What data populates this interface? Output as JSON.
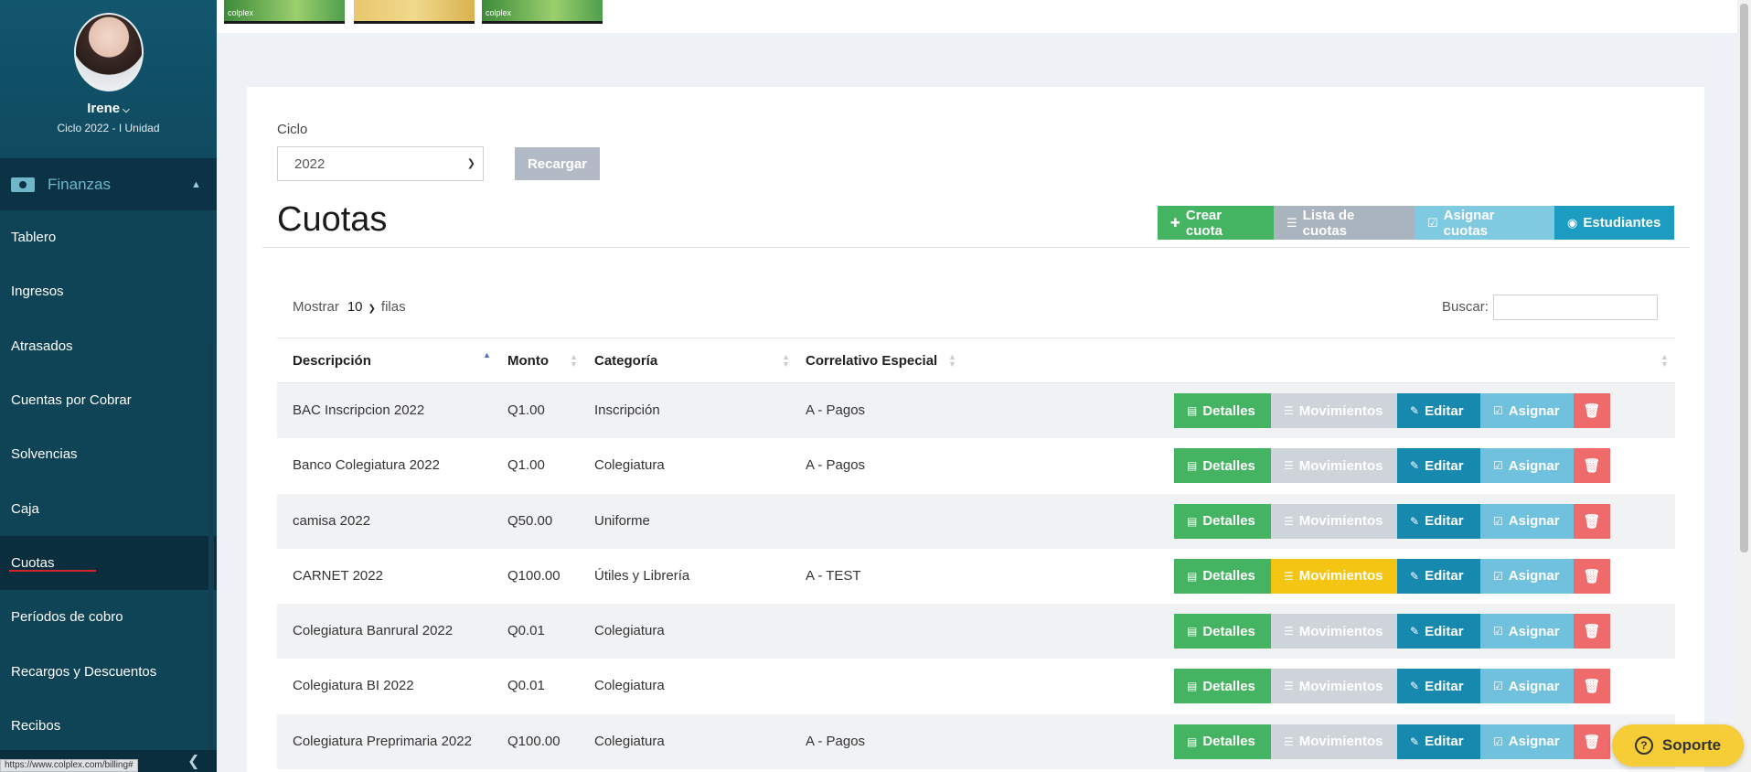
{
  "sidebar": {
    "user_name": "Irene",
    "user_cycle": "Ciclo 2022 - I Unidad",
    "group_label": "Finanzas",
    "items": [
      {
        "label": "Tablero"
      },
      {
        "label": "Ingresos"
      },
      {
        "label": "Atrasados"
      },
      {
        "label": "Cuentas por Cobrar"
      },
      {
        "label": "Solvencias"
      },
      {
        "label": "Caja"
      },
      {
        "label": "Cuotas"
      },
      {
        "label": "Períodos de cobro"
      },
      {
        "label": "Recargos y Descuentos"
      },
      {
        "label": "Recibos"
      }
    ],
    "active_item": "Cuotas",
    "status_url": "https://www.colplex.com/billing#"
  },
  "banners": [
    {
      "text": "colplex"
    },
    {
      "text": ""
    },
    {
      "text": "colplex"
    }
  ],
  "filters": {
    "ciclo_label": "Ciclo",
    "ciclo_value": "2022",
    "reload_label": "Recargar"
  },
  "page": {
    "title": "Cuotas",
    "actions": {
      "create": "Crear cuota",
      "list": "Lista de cuotas",
      "assign": "Asignar cuotas",
      "students": "Estudiantes"
    }
  },
  "table_controls": {
    "show_label": "Mostrar",
    "page_length": "10",
    "rows_label": "filas",
    "search_label": "Buscar:"
  },
  "table": {
    "columns": [
      "Descripción",
      "Monto",
      "Categoría",
      "Correlativo Especial"
    ],
    "button_labels": {
      "details": "Detalles",
      "movements": "Movimientos",
      "edit": "Editar",
      "assign": "Asignar"
    },
    "rows": [
      {
        "descripcion": "BAC Inscripcion 2022",
        "monto": "Q1.00",
        "categoria": "Inscripción",
        "correlativo": "A - Pagos",
        "movimientos_enabled": false
      },
      {
        "descripcion": "Banco Colegiatura 2022",
        "monto": "Q1.00",
        "categoria": "Colegiatura",
        "correlativo": "A - Pagos",
        "movimientos_enabled": false
      },
      {
        "descripcion": "camisa 2022",
        "monto": "Q50.00",
        "categoria": "Uniforme",
        "correlativo": "",
        "movimientos_enabled": false
      },
      {
        "descripcion": "CARNET 2022",
        "monto": "Q100.00",
        "categoria": "Útiles y Librería",
        "correlativo": "A - TEST",
        "movimientos_enabled": true
      },
      {
        "descripcion": "Colegiatura Banrural 2022",
        "monto": "Q0.01",
        "categoria": "Colegiatura",
        "correlativo": "",
        "movimientos_enabled": false
      },
      {
        "descripcion": "Colegiatura BI 2022",
        "monto": "Q0.01",
        "categoria": "Colegiatura",
        "correlativo": "",
        "movimientos_enabled": false
      },
      {
        "descripcion": "Colegiatura Preprimaria 2022",
        "monto": "Q100.00",
        "categoria": "Colegiatura",
        "correlativo": "A - Pagos",
        "movimientos_enabled": false
      }
    ]
  },
  "support": {
    "label": "Soporte"
  },
  "colors": {
    "sidebar_bg": "#0d3d52",
    "success": "#45b462",
    "warning": "#f4c512",
    "info": "#1889ae",
    "danger": "#ef6a6a"
  }
}
